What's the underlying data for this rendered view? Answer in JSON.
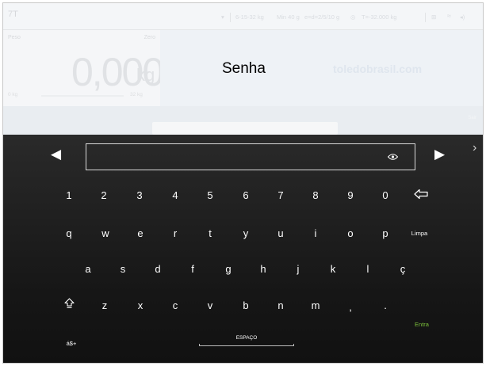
{
  "status_bar": {
    "left_label": "7T",
    "range": "6-15-32 kg",
    "min": "Min 40 g",
    "division": "e=d=2/5/10 g",
    "tare": "T=-32.000 kg"
  },
  "weight_panel": {
    "peso_label": "Peso",
    "zero_label": "Zero",
    "value": "0,000",
    "unit": "kg",
    "min_label": "0 kg",
    "max_label": "32 kg"
  },
  "header": {
    "title": "Senha",
    "site": "toledobrasil.com"
  },
  "strip": {
    "right_label": "Sair"
  },
  "keyboard": {
    "password_value": "",
    "row_numbers": [
      "1",
      "2",
      "3",
      "4",
      "5",
      "6",
      "7",
      "8",
      "9",
      "0"
    ],
    "row_1": [
      "q",
      "w",
      "e",
      "r",
      "t",
      "y",
      "u",
      "i",
      "o",
      "p"
    ],
    "clear_label": "Limpa",
    "row_2": [
      "a",
      "s",
      "d",
      "f",
      "g",
      "h",
      "j",
      "k",
      "l",
      "ç"
    ],
    "row_3": [
      "z",
      "x",
      "c",
      "v",
      "b",
      "n",
      "m",
      ",",
      "."
    ],
    "enter_label": "Entra",
    "symbols_label": "á$+",
    "space_label": "ESPAÇO"
  },
  "colors": {
    "keyboard_bg": "#1a1a1a",
    "enter_green": "#7bbf3b",
    "header_bg": "#eef2f6"
  },
  "icons": [
    "arrow-left-icon",
    "arrow-right-icon",
    "chevron-right-icon",
    "eye-icon",
    "backspace-icon",
    "shift-icon",
    "wifi-icon",
    "volume-icon"
  ]
}
